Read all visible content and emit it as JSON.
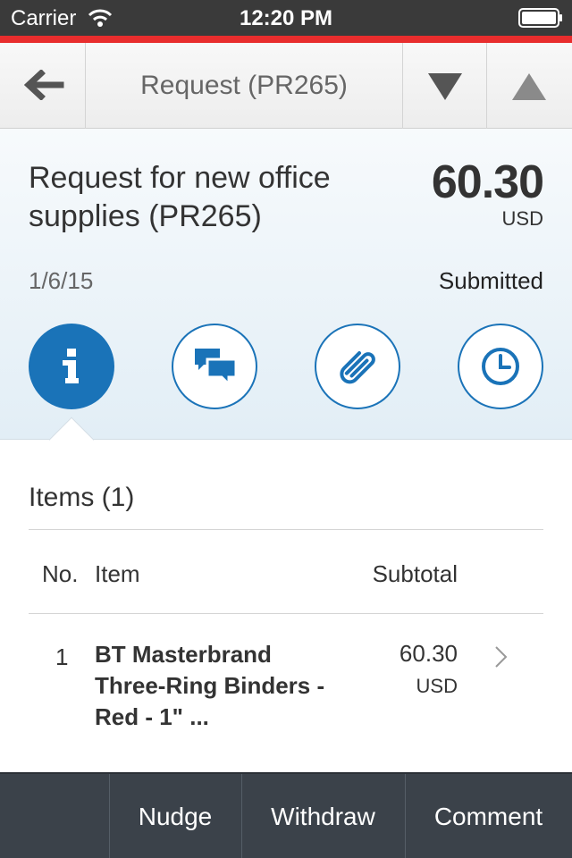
{
  "status_bar": {
    "carrier": "Carrier",
    "time": "12:20 PM"
  },
  "nav": {
    "title": "Request (PR265)"
  },
  "request": {
    "title": "Request for new office supplies (PR265)",
    "amount": "60.30",
    "currency": "USD",
    "date": "1/6/15",
    "status": "Submitted"
  },
  "tabs": [
    {
      "icon": "info-icon",
      "active": true
    },
    {
      "icon": "comments-icon",
      "active": false
    },
    {
      "icon": "attachment-icon",
      "active": false
    },
    {
      "icon": "history-icon",
      "active": false
    }
  ],
  "items": {
    "title": "Items (1)",
    "columns": {
      "no": "No.",
      "item": "Item",
      "subtotal": "Subtotal"
    },
    "rows": [
      {
        "no": "1",
        "name": "BT Masterbrand Three-Ring Binders - Red - 1\" ...",
        "subtotal": "60.30",
        "currency": "USD"
      }
    ]
  },
  "footer": {
    "nudge": "Nudge",
    "withdraw": "Withdraw",
    "comment": "Comment"
  },
  "colors": {
    "accent": "#1a73b8",
    "brand_line": "#e82d2d",
    "toolbar": "#3b424a"
  }
}
